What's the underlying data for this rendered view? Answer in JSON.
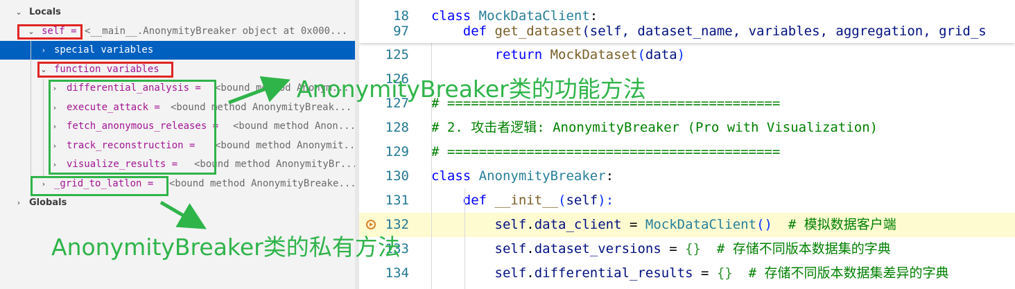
{
  "variables_panel": {
    "locals_label": "Locals",
    "globals_label": "Globals",
    "self_row": {
      "name": "self =",
      "value": "<__main__.AnonymityBreaker object at 0x000..."
    },
    "special_variables": "special variables",
    "function_variables": "function variables",
    "methods": [
      {
        "name": "differential_analysis =",
        "value": "<bound method Anonym..."
      },
      {
        "name": "execute_attack =",
        "value": "<bound method AnonymityBreak..."
      },
      {
        "name": "fetch_anonymous_releases =",
        "value": "<bound method Anon..."
      },
      {
        "name": "track_reconstruction =",
        "value": "<bound method Anonymit..."
      },
      {
        "name": "visualize_results =",
        "value": "<bound method AnonymityBr..."
      }
    ],
    "private_method": {
      "name": "_grid_to_latlon =",
      "value": "<bound method AnonymityBreake..."
    }
  },
  "editor": {
    "sticky": [
      {
        "num": "18",
        "tokens": [
          {
            "t": "class ",
            "c": "kw"
          },
          {
            "t": "MockDataClient",
            "c": "cls"
          },
          {
            "t": ":",
            "c": ""
          }
        ]
      },
      {
        "num": "97",
        "tokens": [
          {
            "t": "    def ",
            "c": "kw"
          },
          {
            "t": "get_dataset",
            "c": "fn"
          },
          {
            "t": "(self, dataset_name, variables, aggregation, grid_s",
            "c": "selfc"
          }
        ]
      }
    ],
    "lines": [
      {
        "num": "125",
        "tokens": [
          {
            "t": "        return ",
            "c": "kw"
          },
          {
            "t": "MockDataset",
            "c": "fn"
          },
          {
            "t": "(",
            "c": "paren"
          },
          {
            "t": "data",
            "c": "selfc"
          },
          {
            "t": ")",
            "c": "paren"
          }
        ]
      },
      {
        "num": "126",
        "tokens": []
      },
      {
        "num": "127",
        "tokens": [
          {
            "t": "# ==========================================",
            "c": "cmt"
          }
        ]
      },
      {
        "num": "128",
        "tokens": [
          {
            "t": "# 2. 攻击者逻辑: AnonymityBreaker (Pro with Visualization)",
            "c": "cmt"
          }
        ]
      },
      {
        "num": "129",
        "tokens": [
          {
            "t": "# ==========================================",
            "c": "cmt"
          }
        ]
      },
      {
        "num": "130",
        "tokens": [
          {
            "t": "class ",
            "c": "kw"
          },
          {
            "t": "AnonymityBreaker",
            "c": "cls"
          },
          {
            "t": ":",
            "c": ""
          }
        ]
      },
      {
        "num": "131",
        "tokens": [
          {
            "t": "    def ",
            "c": "kw"
          },
          {
            "t": "__init__",
            "c": "fn"
          },
          {
            "t": "(",
            "c": "paren"
          },
          {
            "t": "self",
            "c": "selfc"
          },
          {
            "t": "):",
            "c": "paren"
          }
        ]
      },
      {
        "num": "132",
        "tokens": [
          {
            "t": "        self",
            "c": "selfc"
          },
          {
            "t": ".",
            "c": ""
          },
          {
            "t": "data_client",
            "c": "selfc"
          },
          {
            "t": " = ",
            "c": ""
          },
          {
            "t": "MockDataClient",
            "c": "cls"
          },
          {
            "t": "()",
            "c": "paren"
          },
          {
            "t": "  # 模拟数据客户端",
            "c": "cmt"
          }
        ]
      },
      {
        "num": "133",
        "tokens": [
          {
            "t": "        self",
            "c": "selfc"
          },
          {
            "t": ".",
            "c": ""
          },
          {
            "t": "dataset_versions",
            "c": "selfc"
          },
          {
            "t": " = ",
            "c": ""
          },
          {
            "t": "{}",
            "c": "brace"
          },
          {
            "t": "  # 存储不同版本数据集的字典",
            "c": "cmt"
          }
        ]
      },
      {
        "num": "134",
        "tokens": [
          {
            "t": "        self",
            "c": "selfc"
          },
          {
            "t": ".",
            "c": ""
          },
          {
            "t": "differential_results",
            "c": "selfc"
          },
          {
            "t": " = ",
            "c": ""
          },
          {
            "t": "{}",
            "c": "brace"
          },
          {
            "t": "  # 存储不同版本数据集差异的字典",
            "c": "cmt"
          }
        ]
      }
    ]
  },
  "annotations": {
    "public_methods_label": "AnonymityBreaker类的功能方法",
    "private_methods_label": "AnonymityBreaker类的私有方法"
  },
  "colors": {
    "annotation_green": "#2fb44a",
    "annotation_red": "#e02424",
    "selection_blue": "#0060c0",
    "current_line": "#fefbd0"
  }
}
